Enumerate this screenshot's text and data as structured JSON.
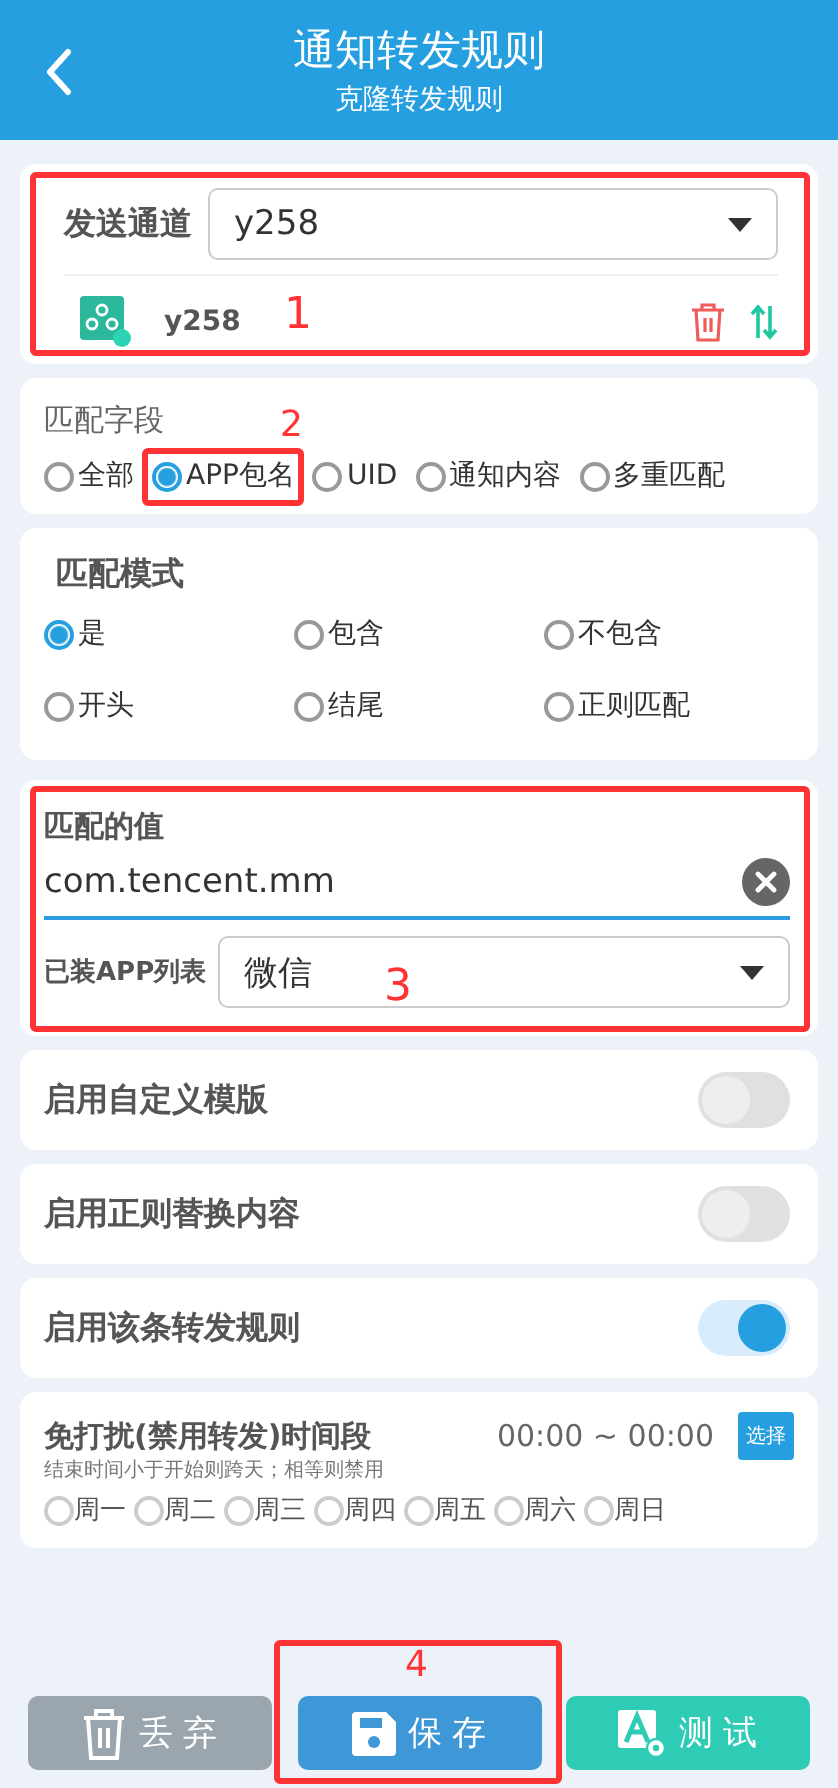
{
  "header": {
    "title": "通知转发规则",
    "subtitle": "克隆转发规则"
  },
  "channel": {
    "label": "发送通道",
    "value": "y258",
    "item_name": "y258",
    "annotation": "1"
  },
  "match_field": {
    "label": "匹配字段",
    "options": [
      {
        "label": "全部",
        "selected": false
      },
      {
        "label": "APP包名",
        "selected": true,
        "annotation": "2"
      },
      {
        "label": "UID",
        "selected": false
      },
      {
        "label": "通知内容",
        "selected": false
      },
      {
        "label": "多重匹配",
        "selected": false
      }
    ]
  },
  "match_mode": {
    "label": "匹配模式",
    "options": [
      {
        "label": "是",
        "selected": true
      },
      {
        "label": "包含",
        "selected": false
      },
      {
        "label": "不包含",
        "selected": false
      },
      {
        "label": "开头",
        "selected": false
      },
      {
        "label": "结尾",
        "selected": false
      },
      {
        "label": "正则匹配",
        "selected": false
      }
    ]
  },
  "match_value": {
    "label": "匹配的值",
    "value": "com.tencent.mm",
    "app_list_label": "已装APP列表",
    "app_value": "微信",
    "annotation": "3"
  },
  "toggles": [
    {
      "label": "启用自定义模版",
      "on": false
    },
    {
      "label": "启用正则替换内容",
      "on": false
    },
    {
      "label": "启用该条转发规则",
      "on": true
    }
  ],
  "dnd": {
    "title": "免打扰(禁用转发)时间段",
    "time": "00:00 ~ 00:00",
    "choose": "选择",
    "hint": "结束时间小于开始则跨天；相等则禁用",
    "days": [
      {
        "label": "周一",
        "selected": false
      },
      {
        "label": "周二",
        "selected": false
      },
      {
        "label": "周三",
        "selected": false
      },
      {
        "label": "周四",
        "selected": false
      },
      {
        "label": "周五",
        "selected": false
      },
      {
        "label": "周六",
        "selected": false
      },
      {
        "label": "周日",
        "selected": false
      }
    ]
  },
  "buttons": [
    {
      "kind": "discard",
      "label": "丢 弃"
    },
    {
      "kind": "save",
      "label": "保 存",
      "annotation": "4"
    },
    {
      "kind": "test",
      "label": "测 试"
    }
  ]
}
